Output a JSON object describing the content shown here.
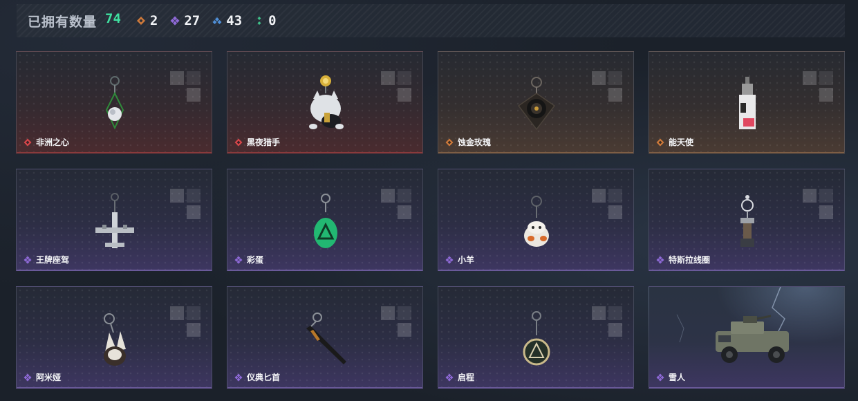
{
  "header": {
    "owned_label": "已拥有数量",
    "owned_count": "74",
    "stats": [
      {
        "icon": "orange-diamond-icon",
        "color": "#d07a3a",
        "value": "2"
      },
      {
        "icon": "purple-diamond-icon",
        "color": "#8f6ad8",
        "value": "27"
      },
      {
        "icon": "blue-diamond-icon",
        "color": "#4f8fd8",
        "value": "43"
      },
      {
        "icon": "green-diamond-icon",
        "color": "#3fc28a",
        "value": "0"
      }
    ]
  },
  "items": [
    {
      "name": "非洲之心",
      "rarity": "red",
      "rarity_color": "#d8464a",
      "icon": "pendant-keychain-icon"
    },
    {
      "name": "黑夜猎手",
      "rarity": "red",
      "rarity_color": "#d8464a",
      "icon": "night-hunter-keychain-icon"
    },
    {
      "name": "蚀金玫瑰",
      "rarity": "orange",
      "rarity_color": "#d07a3a",
      "icon": "rose-keychain-icon"
    },
    {
      "name": "能天使",
      "rarity": "orange",
      "rarity_color": "#d07a3a",
      "icon": "angel-keychain-icon"
    },
    {
      "name": "王牌座驾",
      "rarity": "purple",
      "rarity_color": "#8f6ad8",
      "icon": "aircraft-keychain-icon"
    },
    {
      "name": "彩蛋",
      "rarity": "purple",
      "rarity_color": "#8f6ad8",
      "icon": "egg-keychain-icon"
    },
    {
      "name": "小羊",
      "rarity": "purple",
      "rarity_color": "#8f6ad8",
      "icon": "sheep-keychain-icon"
    },
    {
      "name": "特斯拉线圈",
      "rarity": "purple",
      "rarity_color": "#8f6ad8",
      "icon": "tesla-coil-keychain-icon"
    },
    {
      "name": "阿米娅",
      "rarity": "purple",
      "rarity_color": "#8f6ad8",
      "icon": "amiya-keychain-icon"
    },
    {
      "name": "仪典匕首",
      "rarity": "purple",
      "rarity_color": "#8f6ad8",
      "icon": "dagger-keychain-icon"
    },
    {
      "name": "启程",
      "rarity": "purple",
      "rarity_color": "#8f6ad8",
      "icon": "medal-keychain-icon"
    },
    {
      "name": "雪人",
      "rarity": "purple",
      "rarity_color": "#8f6ad8",
      "icon": "armored-vehicle-icon"
    }
  ]
}
